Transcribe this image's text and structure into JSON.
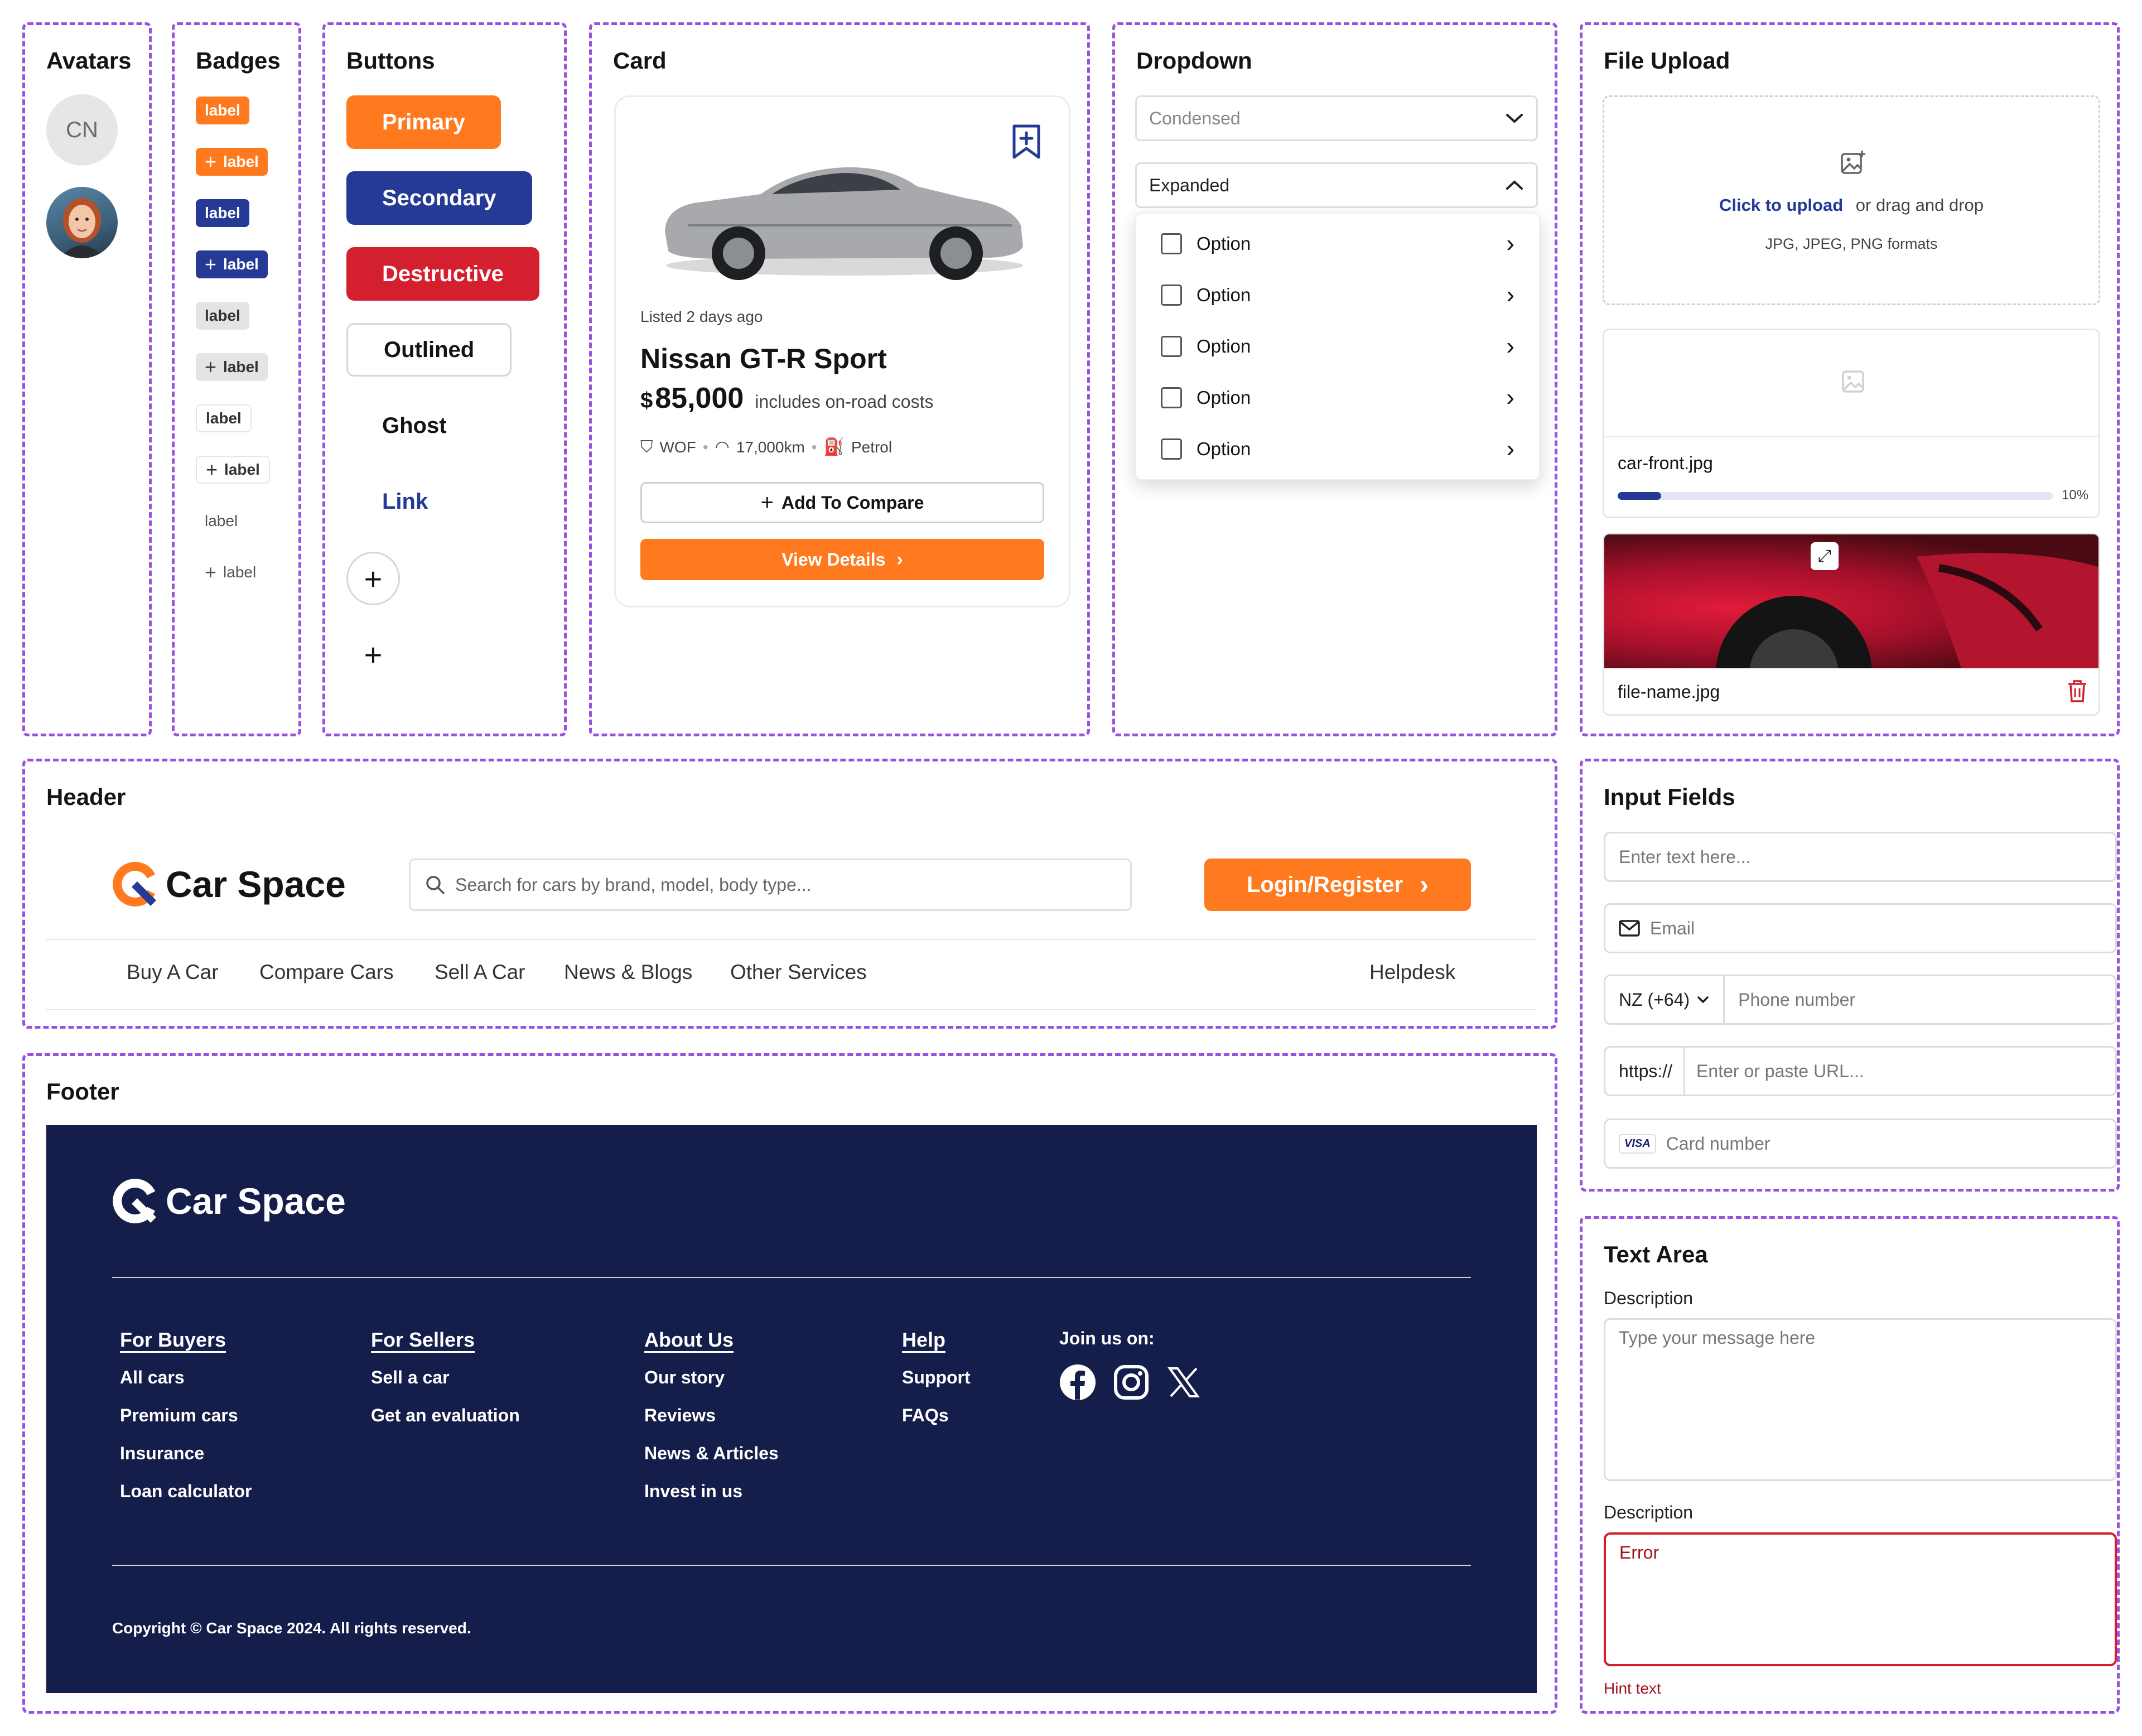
{
  "colors": {
    "accent": "#ff7a1f",
    "navy": "#151d4a",
    "blue": "#253a94",
    "red": "#d41f2f",
    "purple": "#9b51e0"
  },
  "avatars": {
    "title": "Avatars",
    "initials": "CN"
  },
  "badges": {
    "title": "Badges",
    "label": "label"
  },
  "buttons": {
    "title": "Buttons",
    "primary": "Primary",
    "secondary": "Secondary",
    "destructive": "Destructive",
    "outlined": "Outlined",
    "ghost": "Ghost",
    "link": "Link",
    "plus": "+"
  },
  "card": {
    "title": "Card",
    "listed": "Listed 2 days ago",
    "car_name": "Nissan GT-R Sport",
    "currency": "$",
    "price": "85,000",
    "price_note": "includes on-road costs",
    "spec_wof": "WOF",
    "spec_km": "17,000km",
    "spec_fuel": "Petrol",
    "compare_label": "Add To Compare",
    "details_label": "View Details"
  },
  "dropdown": {
    "title": "Dropdown",
    "condensed": "Condensed",
    "expanded": "Expanded",
    "options": [
      "Option",
      "Option",
      "Option",
      "Option",
      "Option"
    ]
  },
  "file_upload": {
    "title": "File Upload",
    "click_text": "Click to upload",
    "drag_text": "or drag and drop",
    "formats": "JPG, JPEG, PNG formats",
    "file1_name": "car-front.jpg",
    "file1_progress": 0.1,
    "file1_progress_label": "10%",
    "file2_name": "file-name.jpg"
  },
  "header": {
    "title": "Header",
    "brand": "Car Space",
    "search_placeholder": "Search for cars by brand, model, body type...",
    "login_label": "Login/Register",
    "nav": [
      "Buy A Car",
      "Compare Cars",
      "Sell A Car",
      "News & Blogs",
      "Other Services"
    ],
    "helpdesk": "Helpdesk"
  },
  "input_fields": {
    "title": "Input Fields",
    "text_placeholder": "Enter text here...",
    "email_placeholder": "Email",
    "country_code": "NZ (+64)",
    "phone_placeholder": "Phone number",
    "url_prefix": "https://",
    "url_placeholder": "Enter or paste URL...",
    "card_brand": "VISA",
    "card_placeholder": "Card number"
  },
  "footer": {
    "title": "Footer",
    "brand": "Car Space",
    "columns": [
      {
        "heading": "For Buyers",
        "links": [
          "All cars",
          "Premium cars",
          "Insurance",
          "Loan calculator"
        ]
      },
      {
        "heading": "For Sellers",
        "links": [
          "Sell a car",
          "Get an evaluation"
        ]
      },
      {
        "heading": "About Us",
        "links": [
          "Our story",
          "Reviews",
          "News & Articles",
          "Invest in us"
        ]
      },
      {
        "heading": "Help",
        "links": [
          "Support",
          "FAQs"
        ]
      }
    ],
    "join": "Join us on:",
    "copyright": "Copyright © Car Space 2024. All rights reserved."
  },
  "text_area": {
    "title": "Text Area",
    "label1": "Description",
    "placeholder1": "Type your message here",
    "label2": "Description",
    "error_value": "Error",
    "hint": "Hint text"
  }
}
